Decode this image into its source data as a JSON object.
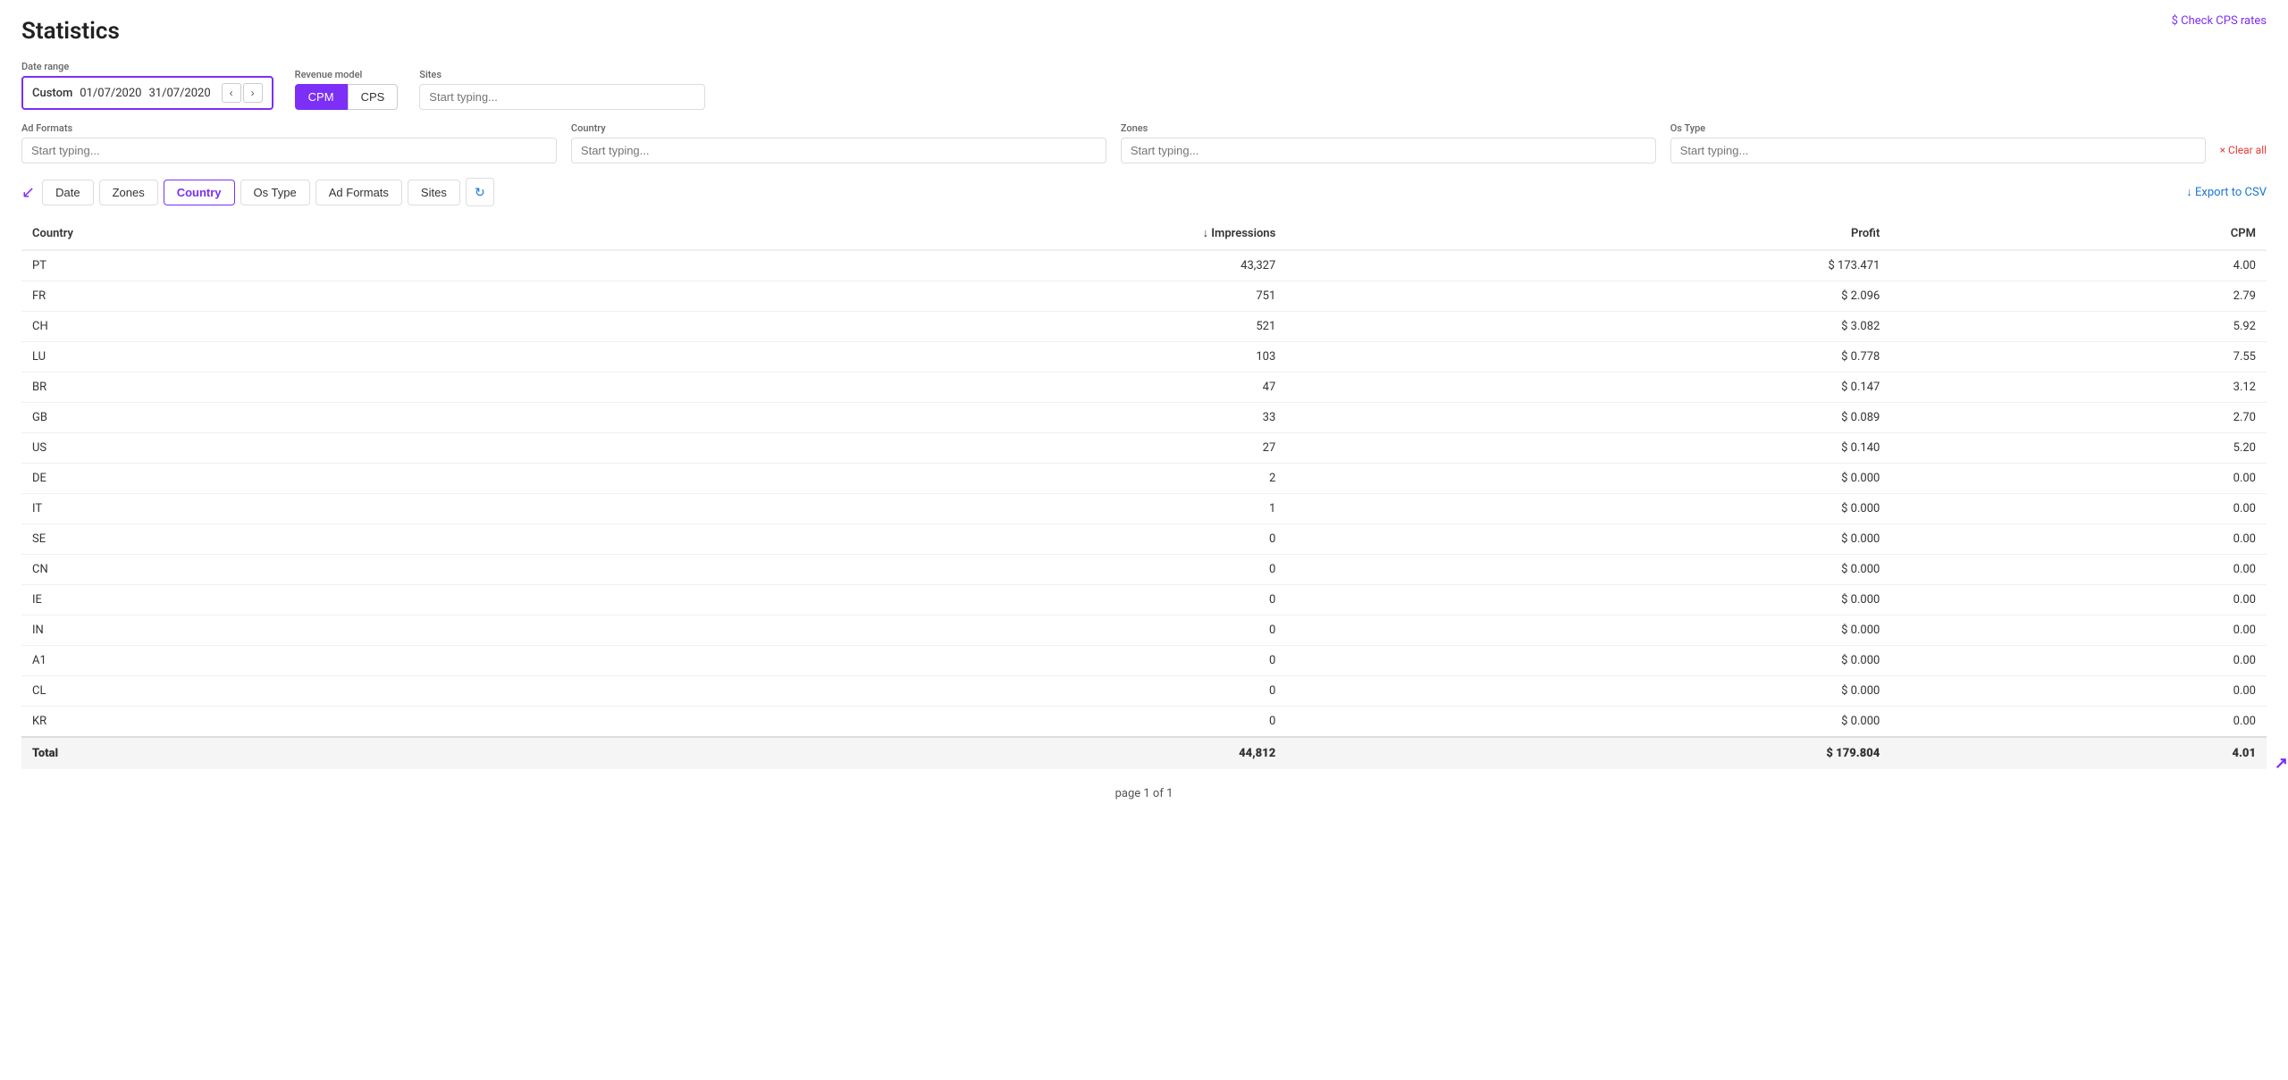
{
  "page": {
    "title": "Statistics",
    "check_cps_label": "$ Check CPS rates"
  },
  "filters": {
    "date_range": {
      "label": "Date range",
      "preset": "Custom",
      "start": "01/07/2020",
      "end": "31/07/2020"
    },
    "revenue_model": {
      "label": "Revenue model",
      "options": [
        "CPM",
        "CPS"
      ],
      "active": "CPM"
    },
    "sites": {
      "label": "Sites",
      "placeholder": "Start typing..."
    },
    "ad_formats": {
      "label": "Ad Formats",
      "placeholder": "Start typing..."
    },
    "country": {
      "label": "Country",
      "placeholder": "Start typing..."
    },
    "zones": {
      "label": "Zones",
      "placeholder": "Start typing..."
    },
    "os_type": {
      "label": "Os Type",
      "placeholder": "Start typing..."
    },
    "clear_all": "× Clear all"
  },
  "tabs": {
    "items": [
      "Date",
      "Zones",
      "Country",
      "Os Type",
      "Ad Formats",
      "Sites"
    ],
    "active": "Country"
  },
  "export_label": "↓ Export to CSV",
  "table": {
    "columns": [
      "Country",
      "Impressions",
      "Profit",
      "CPM"
    ],
    "impressions_sort": "↓",
    "rows": [
      {
        "country": "PT",
        "impressions": "43,327",
        "profit": "$ 173.471",
        "cpm": "4.00"
      },
      {
        "country": "FR",
        "impressions": "751",
        "profit": "$ 2.096",
        "cpm": "2.79"
      },
      {
        "country": "CH",
        "impressions": "521",
        "profit": "$ 3.082",
        "cpm": "5.92"
      },
      {
        "country": "LU",
        "impressions": "103",
        "profit": "$ 0.778",
        "cpm": "7.55"
      },
      {
        "country": "BR",
        "impressions": "47",
        "profit": "$ 0.147",
        "cpm": "3.12"
      },
      {
        "country": "GB",
        "impressions": "33",
        "profit": "$ 0.089",
        "cpm": "2.70"
      },
      {
        "country": "US",
        "impressions": "27",
        "profit": "$ 0.140",
        "cpm": "5.20"
      },
      {
        "country": "DE",
        "impressions": "2",
        "profit": "$ 0.000",
        "cpm": "0.00"
      },
      {
        "country": "IT",
        "impressions": "1",
        "profit": "$ 0.000",
        "cpm": "0.00"
      },
      {
        "country": "SE",
        "impressions": "0",
        "profit": "$ 0.000",
        "cpm": "0.00"
      },
      {
        "country": "CN",
        "impressions": "0",
        "profit": "$ 0.000",
        "cpm": "0.00"
      },
      {
        "country": "IE",
        "impressions": "0",
        "profit": "$ 0.000",
        "cpm": "0.00"
      },
      {
        "country": "IN",
        "impressions": "0",
        "profit": "$ 0.000",
        "cpm": "0.00"
      },
      {
        "country": "A1",
        "impressions": "0",
        "profit": "$ 0.000",
        "cpm": "0.00"
      },
      {
        "country": "CL",
        "impressions": "0",
        "profit": "$ 0.000",
        "cpm": "0.00"
      },
      {
        "country": "KR",
        "impressions": "0",
        "profit": "$ 0.000",
        "cpm": "0.00"
      }
    ],
    "total": {
      "label": "Total",
      "impressions": "44,812",
      "profit": "$ 179.804",
      "cpm": "4.01"
    }
  },
  "pagination": {
    "text": "page 1 of 1"
  }
}
